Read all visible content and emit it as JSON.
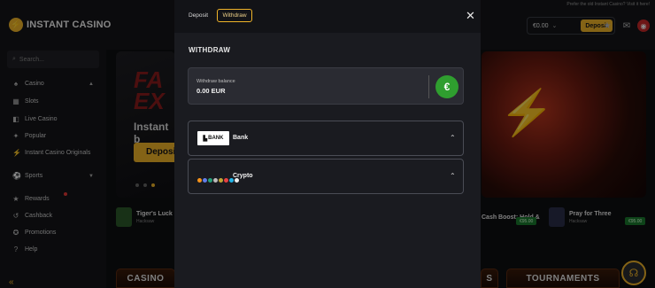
{
  "site": {
    "logo_text": "INSTANT CASINO",
    "promo_line": "Prefer the old Instant Casino? Visit it here!",
    "balance": "€0.00",
    "deposit_label": "Deposit",
    "search_placeholder": "Search...",
    "nav": [
      {
        "label": "Casino",
        "icon": "casino-icon"
      },
      {
        "label": "Slots",
        "icon": "slots-icon"
      },
      {
        "label": "Live Casino",
        "icon": "live-casino-icon"
      },
      {
        "label": "Popular",
        "icon": "popular-icon"
      },
      {
        "label": "Instant Casino Originals",
        "icon": "originals-icon"
      },
      {
        "label": "Sports",
        "icon": "sports-icon"
      },
      {
        "label": "Rewards",
        "icon": "rewards-icon"
      },
      {
        "label": "Cashback",
        "icon": "cashback-icon"
      },
      {
        "label": "Promotions",
        "icon": "promotions-icon"
      },
      {
        "label": "Help",
        "icon": "help-icon"
      }
    ],
    "banner": {
      "big_text": "FA\nEX",
      "sub_text": "Instant b",
      "button": "Deposit"
    },
    "games": [
      {
        "title": "Tiger's Luck - H",
        "sub": "Hacksaw"
      },
      {
        "title": "Cash Boost: Hold &",
        "sub": "",
        "pill": "€95.00"
      },
      {
        "title": "Pray for Three",
        "sub": "Hacksaw",
        "pill": "€95.00"
      }
    ],
    "categories": [
      "CASINO",
      "S",
      "TOURNAMENTS"
    ],
    "colors": {
      "accent": "#f0b429",
      "green": "#2f9e2f"
    }
  },
  "modal": {
    "tabs": [
      "Deposit",
      "Withdraw"
    ],
    "active_tab": "Withdraw",
    "heading": "WITHDRAW",
    "balance_label": "Withdraw balance",
    "balance_value": "0.00 EUR",
    "currency_symbol": "€",
    "methods": [
      {
        "label": "Bank",
        "logo_text": "BANK"
      },
      {
        "label": "Crypto"
      }
    ]
  }
}
